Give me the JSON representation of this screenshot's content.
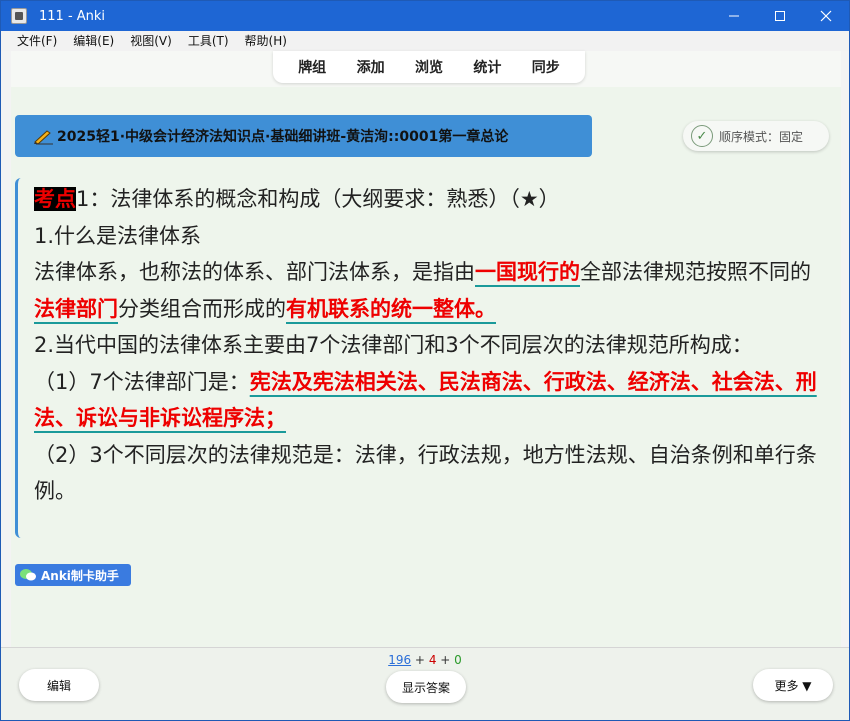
{
  "window": {
    "title": "111 - Anki",
    "controls": {
      "minimize": "—",
      "maximize": "☐",
      "close": "✕"
    }
  },
  "menu": {
    "items": [
      "文件(F)",
      "编辑(E)",
      "视图(V)",
      "工具(T)",
      "帮助(H)"
    ]
  },
  "toolbar": {
    "items": [
      "牌组",
      "添加",
      "浏览",
      "统计",
      "同步"
    ]
  },
  "deck": {
    "name": "2025轻1·中级会计经济法知识点·基础细讲班-黄洁洵::0001第一章总论",
    "order_mode": "顺序模式：固定"
  },
  "content": {
    "tag": "考点",
    "title_rest": "1：法律体系的概念和构成（大纲要求：熟悉）（★）",
    "h1": "1.什么是法律体系",
    "p1_a": "法律体系，也称法的体系、部门法体系，是指由",
    "p1_b": "一国现行的",
    "p1_c": "全部法律规范按照不同的",
    "p1_d": "法律部门",
    "p1_e": "分类组合而形成的",
    "p1_f": "有机联系的统一整体。",
    "h2": "2.当代中国的法律体系主要由7个法律部门和3个不同层次的法律规范所构成：",
    "p2_a": "（1）7个法律部门是：",
    "p2_b": "宪法及宪法相关法、民法商法、行政法、经济法、社会法、刑法、诉讼与非诉讼程序法；",
    "p3": "（2）3个不同层次的法律规范是：法律，行政法规，地方性法规、自治条例和单行条例。"
  },
  "helper": {
    "label": "Anki制卡助手"
  },
  "bottom": {
    "count_new": "196",
    "count_learn": "4",
    "count_review": "0",
    "plus": "+",
    "edit_label": "编辑",
    "show_answer_label": "显示答案",
    "more_label": "更多 ▼"
  },
  "colors": {
    "titlebar": "#1e66d4",
    "deck_banner": "#3f8fd6",
    "card_bg": "#eef5ec",
    "highlight_red": "#e00000",
    "underline_teal": "#1a9a9a"
  }
}
